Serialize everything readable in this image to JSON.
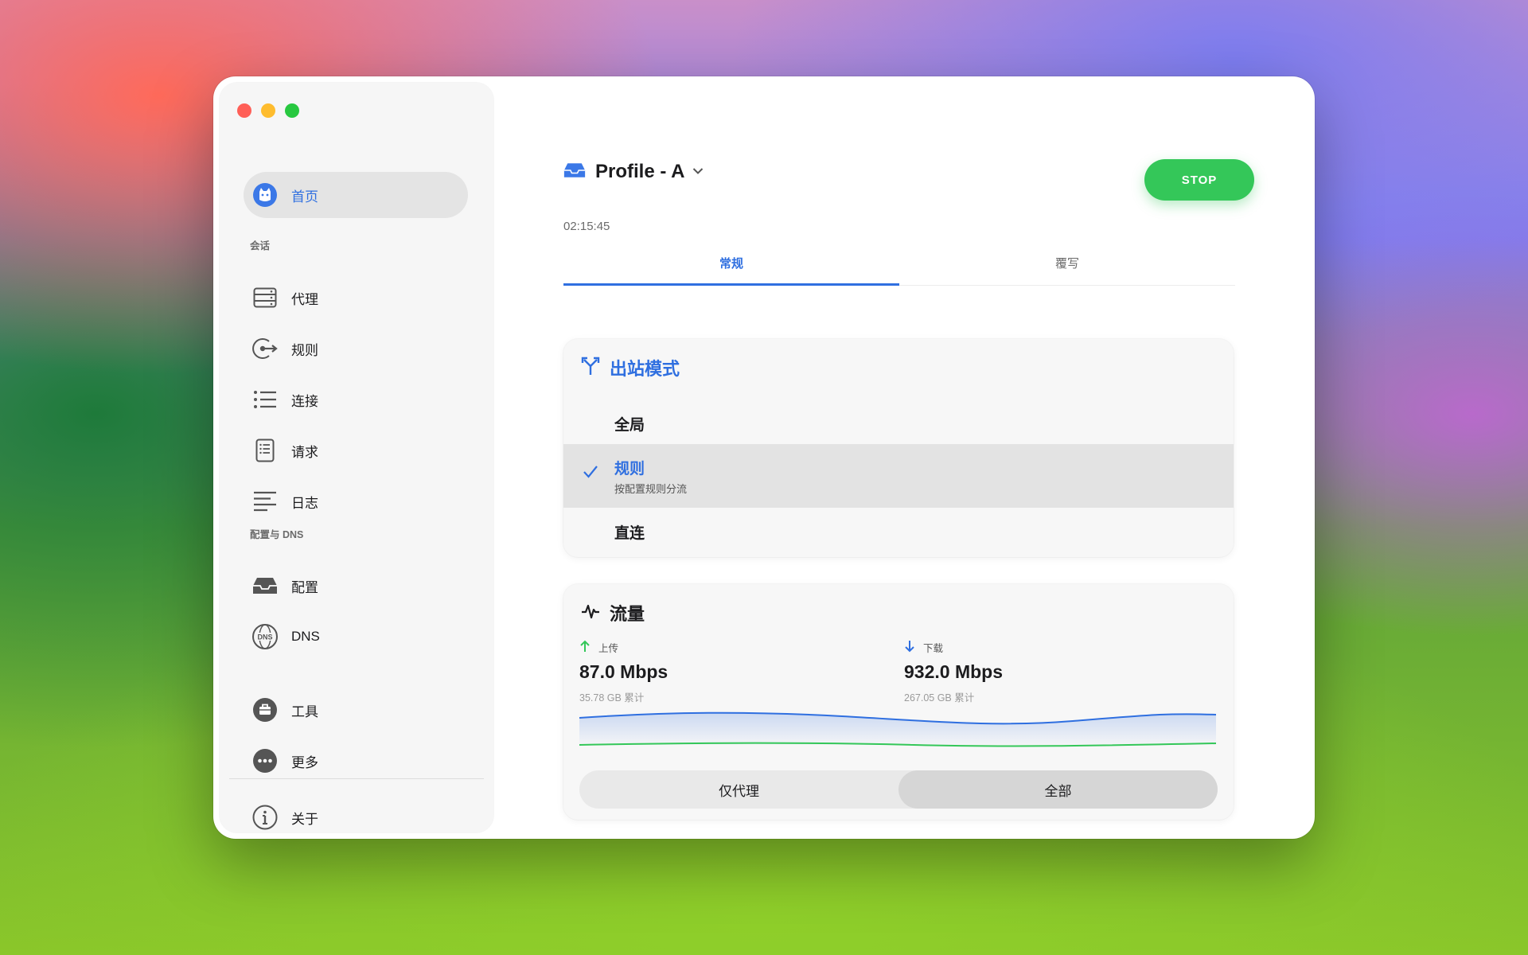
{
  "sidebar": {
    "home": {
      "label": "首页",
      "icon": "cat-avatar-icon"
    },
    "section_session": "会话",
    "session_items": [
      {
        "label": "代理",
        "icon": "server-icon"
      },
      {
        "label": "规则",
        "icon": "rule-routing-icon"
      },
      {
        "label": "连接",
        "icon": "list-icon"
      },
      {
        "label": "请求",
        "icon": "request-document-icon"
      },
      {
        "label": "日志",
        "icon": "log-lines-icon"
      }
    ],
    "section_config": "配置与 DNS",
    "config_items": [
      {
        "label": "配置",
        "icon": "profile-tray-icon"
      },
      {
        "label": "DNS",
        "icon": "dns-globe-icon"
      }
    ],
    "extra_items": [
      {
        "label": "工具",
        "icon": "toolbox-icon"
      },
      {
        "label": "更多",
        "icon": "more-icon"
      }
    ],
    "about": {
      "label": "关于",
      "icon": "info-icon"
    }
  },
  "main": {
    "profile_title": "Profile - A",
    "timer": "02:15:45",
    "stop_label": "STOP",
    "tabs": [
      {
        "label": "常规",
        "active": true
      },
      {
        "label": "覆写",
        "active": false
      }
    ]
  },
  "outbound": {
    "title": "出站模式",
    "options": [
      {
        "label": "全局",
        "selected": false
      },
      {
        "label": "规则",
        "sub": "按配置规则分流",
        "selected": true
      },
      {
        "label": "直连",
        "selected": false
      }
    ]
  },
  "traffic": {
    "title": "流量",
    "upload": {
      "label": "上传",
      "value": "87.0 Mbps",
      "total": "35.78 GB 累计"
    },
    "download": {
      "label": "下载",
      "value": "932.0 Mbps",
      "total": "267.05 GB 累计"
    },
    "filter": [
      "仅代理",
      "全部"
    ],
    "filter_selected": "全部"
  },
  "colors": {
    "accent": "#2f6fe0",
    "stop": "#34c759",
    "upload": "#34c759",
    "download": "#2f6fe0"
  }
}
